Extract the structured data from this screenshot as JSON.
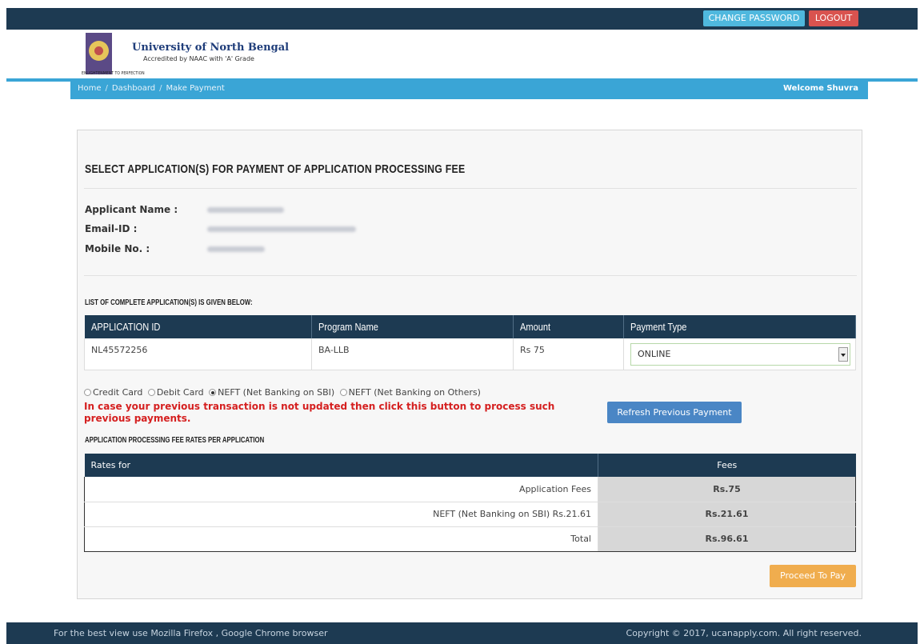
{
  "header": {
    "change_password_label": "CHANGE PASSWORD",
    "logout_label": "LOGOUT",
    "university_name": "University of North Bengal",
    "accreditation": "Accredited by NAAC with 'A' Grade",
    "logo_motto": "ENLIGHTENMENT TO PERFECTION"
  },
  "nav": {
    "breadcrumbs": [
      "Home",
      "Dashboard",
      "Make Payment"
    ],
    "separator": "/",
    "welcome": "Welcome Shuvra"
  },
  "panel": {
    "title": "SELECT APPLICATION(S) FOR PAYMENT OF APPLICATION PROCESSING FEE",
    "applicant_name_label": "Applicant Name :",
    "email_label": "Email-ID :",
    "mobile_label": "Mobile No. :",
    "list_title": "LIST OF COMPLETE APPLICATION(S) IS GIVEN BELOW:"
  },
  "applications": {
    "headers": [
      "APPLICATION ID",
      "Program Name",
      "Amount",
      "Payment Type"
    ],
    "rows": [
      {
        "application_id": "NL45572256",
        "program": "BA-LLB",
        "amount": "Rs 75",
        "payment_type": "ONLINE"
      }
    ]
  },
  "payment_methods": {
    "options": [
      "Credit Card",
      "Debit Card",
      "NEFT (Net Banking on SBI)",
      "NEFT (Net Banking on Others)"
    ],
    "selected": "NEFT (Net Banking on SBI)"
  },
  "warning_text": "In case your previous transaction is not updated then click this button to process such previous payments.",
  "refresh_button_label": "Refresh Previous Payment",
  "rates": {
    "title": "APPLICATION PROCESSING FEE RATES PER APPLICATION",
    "headers": [
      "Rates for",
      "Fees"
    ],
    "rows": [
      {
        "label": "Application Fees",
        "fee": "Rs.75"
      },
      {
        "label": "NEFT (Net Banking on SBI) Rs.21.61",
        "fee": "Rs.21.61"
      },
      {
        "label": "Total",
        "fee": "Rs.96.61"
      }
    ]
  },
  "proceed_button_label": "Proceed To Pay",
  "footer": {
    "left": "For the best view use Mozilla Firefox , Google Chrome browser",
    "right": "Copyright © 2017, ucanapply.com. All right reserved."
  },
  "colors": {
    "navy": "#1d3a52",
    "nav_blue": "#3aa5d6",
    "logout_red": "#d9534f",
    "change_pw_blue": "#4fb8de",
    "warning_red": "#d52020",
    "refresh_blue": "#4a86c5",
    "proceed_orange": "#f0ad4e"
  }
}
